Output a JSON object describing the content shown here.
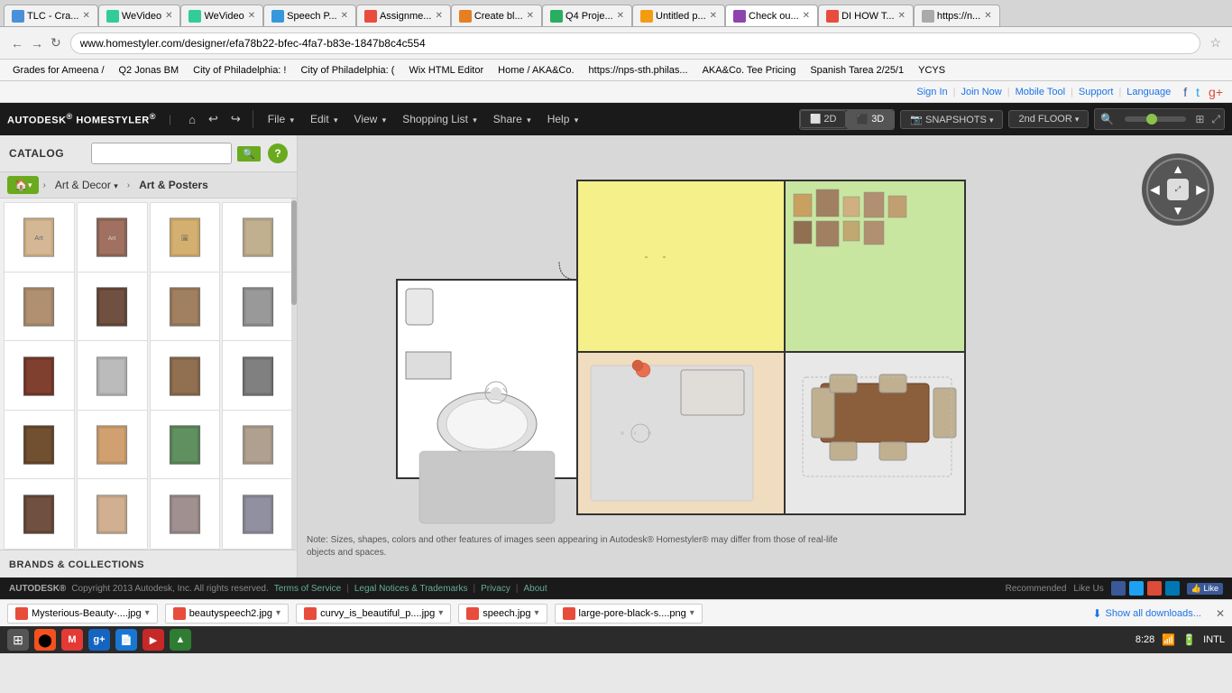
{
  "browser": {
    "tabs": [
      {
        "id": "tlc",
        "label": "TLC - Cra...",
        "icon_color": "#4a90d9",
        "active": false
      },
      {
        "id": "wevideo1",
        "label": "WeVideo",
        "icon_color": "#e74c3c",
        "active": false
      },
      {
        "id": "wevideo2",
        "label": "WeVideo",
        "icon_color": "#e74c3c",
        "active": false
      },
      {
        "id": "speech",
        "label": "Speech P...",
        "icon_color": "#3498db",
        "active": false
      },
      {
        "id": "assign",
        "label": "Assignme...",
        "icon_color": "#e74c3c",
        "active": false
      },
      {
        "id": "create",
        "label": "Create bl...",
        "icon_color": "#e67e22",
        "active": false
      },
      {
        "id": "q4",
        "label": "Q4 Proje...",
        "icon_color": "#27ae60",
        "active": false
      },
      {
        "id": "untitled",
        "label": "Untitled p...",
        "icon_color": "#f39c12",
        "active": false
      },
      {
        "id": "checkout",
        "label": "Check ou...",
        "icon_color": "#8e44ad",
        "active": true
      },
      {
        "id": "howto",
        "label": "DI HOW T...",
        "icon_color": "#e74c3c",
        "active": false
      },
      {
        "id": "https",
        "label": "https://n...",
        "icon_color": "#aaa",
        "active": false
      }
    ],
    "address": "www.homestyler.com/designer/efa78b22-bfec-4fa7-b83e-1847b8c4c554"
  },
  "bookmarks": [
    "Grades for Ameena /",
    "Q2 Jonas BM",
    "City of Philadelphia:",
    "City of Philadelphia:",
    "Wix HTML Editor",
    "Home / AKA&Co.",
    "https://nps-sth.philas...",
    "AKA&Co. Tee Pricing",
    "Spanish Tarea 2/25/1",
    "YCYS"
  ],
  "app": {
    "name": "AUTODESK® HOMESTYLER®",
    "divider": "|",
    "signin": "Sign In",
    "join": "Join Now",
    "mobile_tool": "Mobile Tool",
    "support": "Support",
    "language": "Language"
  },
  "toolbar": {
    "file": "File",
    "edit": "Edit",
    "view": "View",
    "shopping_list": "Shopping List",
    "share": "Share",
    "help": "Help",
    "btn_2d": "2D",
    "btn_3d": "3D",
    "btn_snapshots": "SNAPSHOTS",
    "btn_floor": "2nd FLOOR"
  },
  "catalog": {
    "title": "CATALOG",
    "search_placeholder": "",
    "category_home": "🏠",
    "category_art": "Art & Decor",
    "category_sub": "Art & Posters",
    "brands_title": "BRANDS & COLLECTIONS",
    "items": [
      {
        "id": 1
      },
      {
        "id": 2
      },
      {
        "id": 3
      },
      {
        "id": 4
      },
      {
        "id": 5
      },
      {
        "id": 6
      },
      {
        "id": 7
      },
      {
        "id": 8
      },
      {
        "id": 9
      },
      {
        "id": 10
      },
      {
        "id": 11
      },
      {
        "id": 12
      },
      {
        "id": 13
      },
      {
        "id": 14
      },
      {
        "id": 15
      },
      {
        "id": 16
      },
      {
        "id": 17
      },
      {
        "id": 18
      },
      {
        "id": 19
      },
      {
        "id": 20
      }
    ]
  },
  "footer": {
    "note": "Note: Sizes, shapes, colors and other features of images seen appearing in Autodesk® Homestyler® may differ from those of real-life objects and spaces.",
    "copyright": "Copyright 2013 Autodesk, Inc. All rights reserved.",
    "terms": "Terms of Service",
    "legal": "Legal Notices & Trademarks",
    "privacy": "Privacy",
    "about": "About",
    "recommended": "Recommended",
    "like_us": "Like Us"
  },
  "downloads": [
    {
      "label": "Mysterious-Beauty-....jpg",
      "color": "#e74c3c"
    },
    {
      "label": "beautyspeech2.jpg",
      "color": "#e74c3c"
    },
    {
      "label": "curvy_is_beautiful_p....jpg",
      "color": "#e74c3c"
    },
    {
      "label": "speech.jpg",
      "color": "#e74c3c"
    },
    {
      "label": "large-pore-black-s....png",
      "color": "#e74c3c"
    }
  ],
  "downloads_show_all": "Show all downloads...",
  "taskbar": {
    "time": "8:28",
    "lang": "INTL"
  }
}
